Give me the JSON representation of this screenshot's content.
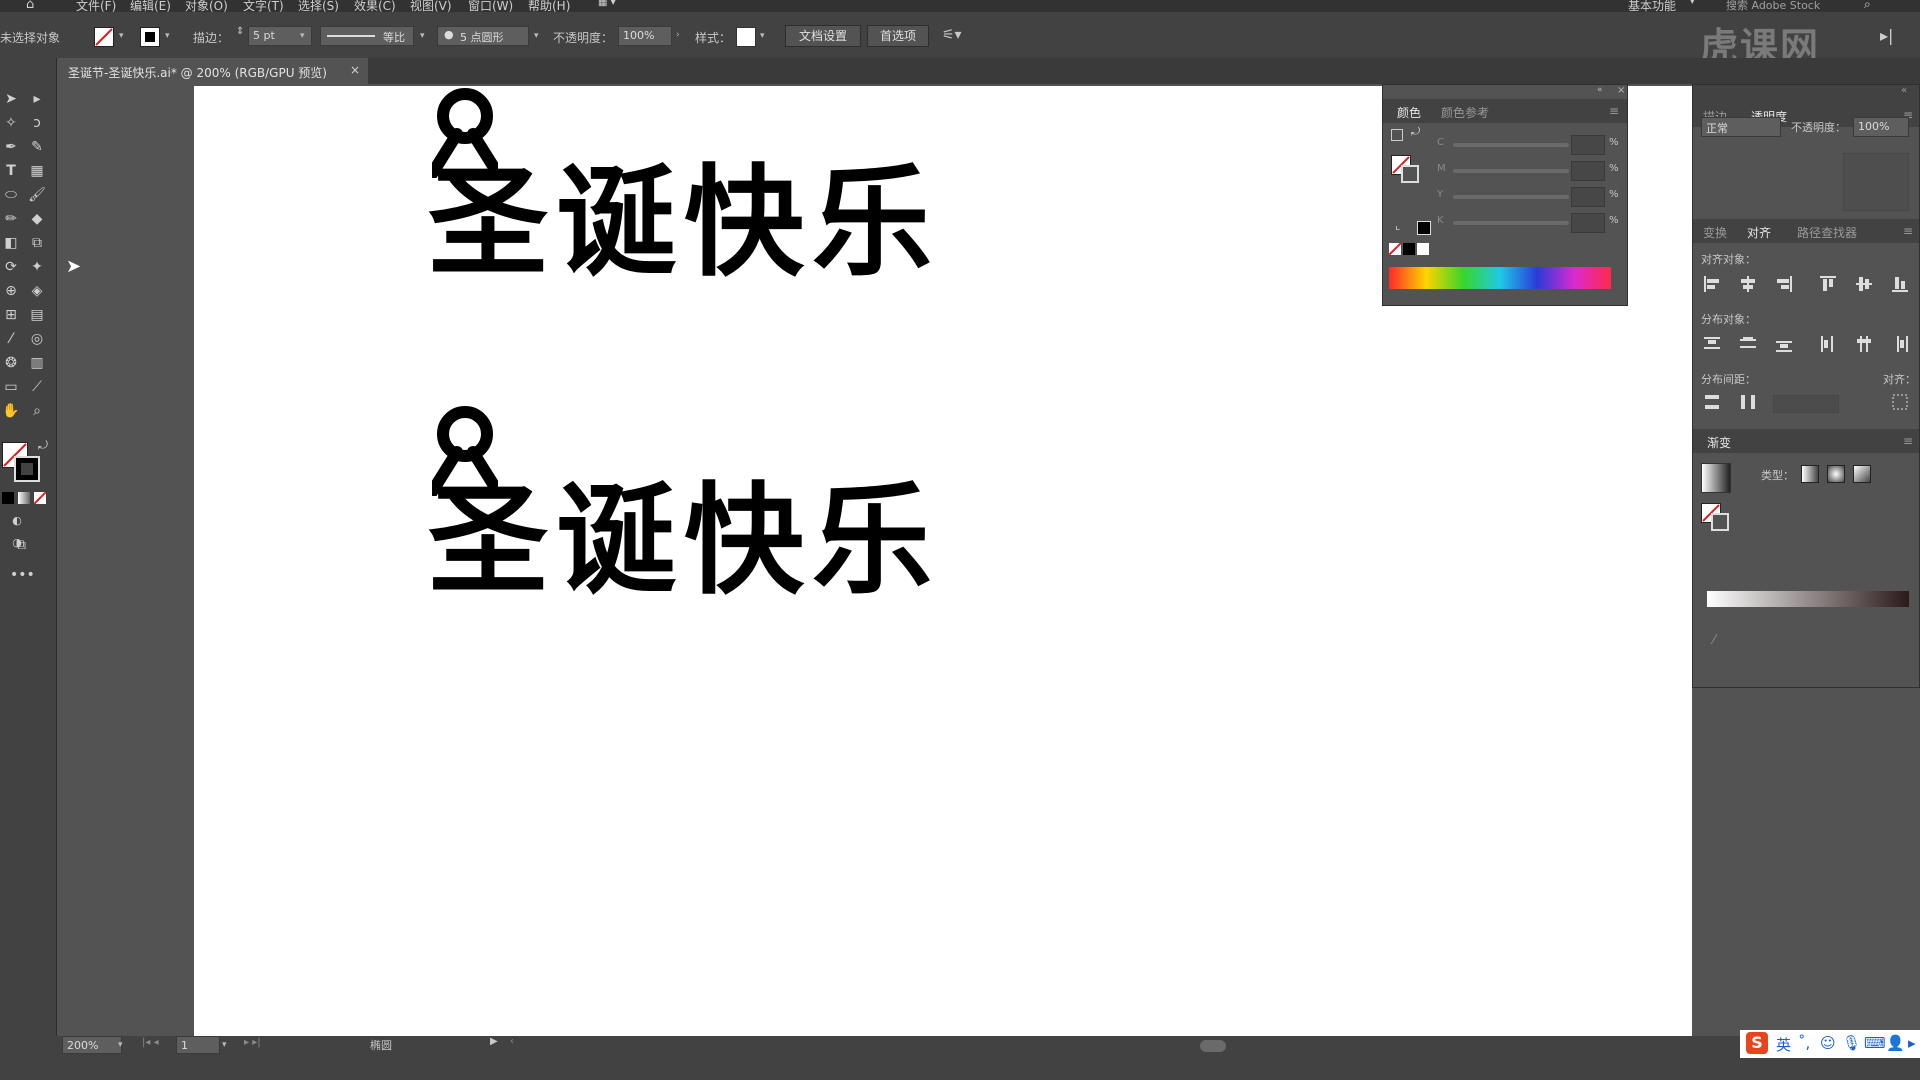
{
  "menu": [
    "文件(F)",
    "编辑(E)",
    "对象(O)",
    "文字(T)",
    "选择(S)",
    "效果(C)",
    "视图(V)",
    "窗口(W)",
    "帮助(H)"
  ],
  "workspace": "基本功能",
  "search_placeholder": "搜索 Adobe Stock",
  "watermark": "虎课网",
  "control_bar": {
    "selection_status": "未选择对象",
    "stroke_label": "描边：",
    "stroke_weight": "5 pt",
    "profile_label": "等比",
    "brush_label": "5 点圆形",
    "opacity_label": "不透明度：",
    "opacity_value": "100%",
    "style_label": "样式：",
    "doc_setup_button": "文档设置",
    "prefs_button": "首选项"
  },
  "doc_tab": {
    "title": "圣诞节-圣诞快乐.ai* @ 200% (RGB/GPU 预览)",
    "close": "×"
  },
  "artwork": {
    "text_top": "圣诞快乐",
    "text_bottom": "圣诞快乐"
  },
  "color_panel": {
    "tabs": [
      "颜色",
      "颜色参考"
    ],
    "channels": [
      "C",
      "M",
      "Y",
      "K"
    ],
    "percent": "%",
    "spectrum": [
      "#ff2a2a",
      "#ffd400",
      "#39d62a",
      "#1fc8e6",
      "#2a3bd9",
      "#d92ad0",
      "#ff2a4a"
    ]
  },
  "right_panel": {
    "top_tabs": [
      "描边",
      "透明度"
    ],
    "blend_mode": "正常",
    "opacity_label": "不透明度：",
    "opacity_value": "100%",
    "mid_tabs": [
      "变换",
      "对齐",
      "路径查找器"
    ],
    "align_objects_label": "对齐对象：",
    "distribute_objects_label": "分布对象：",
    "distribute_spacing_label": "分布间距：",
    "align_to_label": "对齐：",
    "gradient_title": "渐变",
    "gradient_type_label": "类型："
  },
  "status_bar": {
    "zoom": "200%",
    "artboard_num": "1",
    "tool_name": "椭圆"
  },
  "taskbar": {
    "ime": "英"
  }
}
